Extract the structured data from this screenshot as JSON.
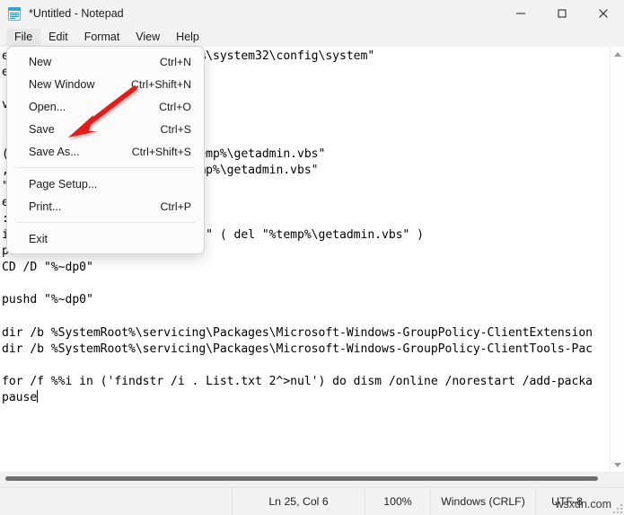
{
  "window": {
    "title": "*Untitled - Notepad",
    "icon": "notepad-icon",
    "controls": {
      "minimize": "minimize-icon",
      "maximize": "maximize-icon",
      "close": "close-icon"
    }
  },
  "menubar": {
    "items": [
      {
        "label": "File",
        "active": true
      },
      {
        "label": "Edit",
        "active": false
      },
      {
        "label": "Format",
        "active": false
      },
      {
        "label": "View",
        "active": false
      },
      {
        "label": "Help",
        "active": false
      }
    ]
  },
  "file_menu": {
    "groups": [
      [
        {
          "label": "New",
          "accel": "Ctrl+N"
        },
        {
          "label": "New Window",
          "accel": "Ctrl+Shift+N"
        },
        {
          "label": "Open...",
          "accel": "Ctrl+O"
        },
        {
          "label": "Save",
          "accel": "Ctrl+S"
        },
        {
          "label": "Save As...",
          "accel": "Ctrl+Shift+S"
        }
      ],
      [
        {
          "label": "Page Setup...",
          "accel": ""
        },
        {
          "label": "Print...",
          "accel": "Ctrl+P"
        }
      ],
      [
        {
          "label": "Exit",
          "accel": ""
        }
      ]
    ]
  },
  "annotation": {
    "type": "red-arrow",
    "color": "#e01b1b",
    "points_to": "Save As..."
  },
  "editor": {
    "content": "em32\\cacls.exe\" \"%SYSTEMROOT%\\system32\\config\\system\"\ne do not have admin.\n\nve privileges...\n\n\n(\"Shell.Application\"^) > \"%temp%\\getadmin.vbs\"\n, \"\", \"\", \"runas\", 1 >> \"%temp%\\getadmin.vbs\"\n\"%temp%\\getadmin.vbs\"\nexit /B\n:gotAdmin\nif exist \"%temp%\\getadmin.vbs\" ( del \"%temp%\\getadmin.vbs\" )\npushd \"%CD%\"\nCD /D \"%~dp0\"\n\npushd \"%~dp0\"\n\ndir /b %SystemRoot%\\servicing\\Packages\\Microsoft-Windows-GroupPolicy-ClientExtension\ndir /b %SystemRoot%\\servicing\\Packages\\Microsoft-Windows-GroupPolicy-ClientTools-Pac\n\nfor /f %%i in ('findstr /i . List.txt 2^>nul') do dism /online /norestart /add-packa\npause",
    "caret_visible": true
  },
  "statusbar": {
    "line_col": "Ln 25, Col 6",
    "zoom": "100%",
    "line_ending": "Windows (CRLF)",
    "encoding": "UTF-8",
    "watermark": "wsxdn.com"
  }
}
